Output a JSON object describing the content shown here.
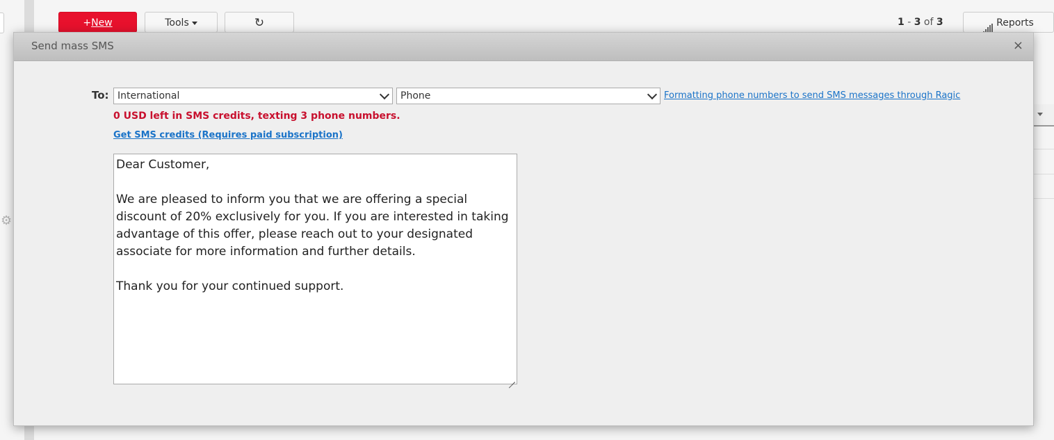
{
  "toolbar": {
    "new_plus": "+",
    "new_label": "New",
    "tools_label": "Tools",
    "refresh_icon": "↻",
    "reports_label": "Reports"
  },
  "pager": {
    "from": "1",
    "to": "3",
    "of_label": "of",
    "total": "3"
  },
  "icons": {
    "gear": "⚙",
    "close": "×"
  },
  "modal": {
    "title": "Send mass SMS",
    "to_label": "To:",
    "region_select": {
      "value": "International"
    },
    "field_select": {
      "value": "Phone"
    },
    "help_link": "Formatting phone numbers to send SMS messages through Ragic",
    "credit_note": "0 USD left in SMS credits, texting 3 phone numbers.",
    "get_credits_link": "Get SMS credits (Requires paid subscription)",
    "message": {
      "greeting": "Dear Customer,",
      "body": "We are pleased to inform you that we are offering a special discount of 20% exclusively for you. If you are interested in taking advantage of this offer, please reach out to your designated associate for more information and further details.",
      "closing": "Thank you for your continued support."
    }
  },
  "colors": {
    "new_button": "#e8112d",
    "warning_text": "#c8102e",
    "link": "#1a73c8"
  }
}
